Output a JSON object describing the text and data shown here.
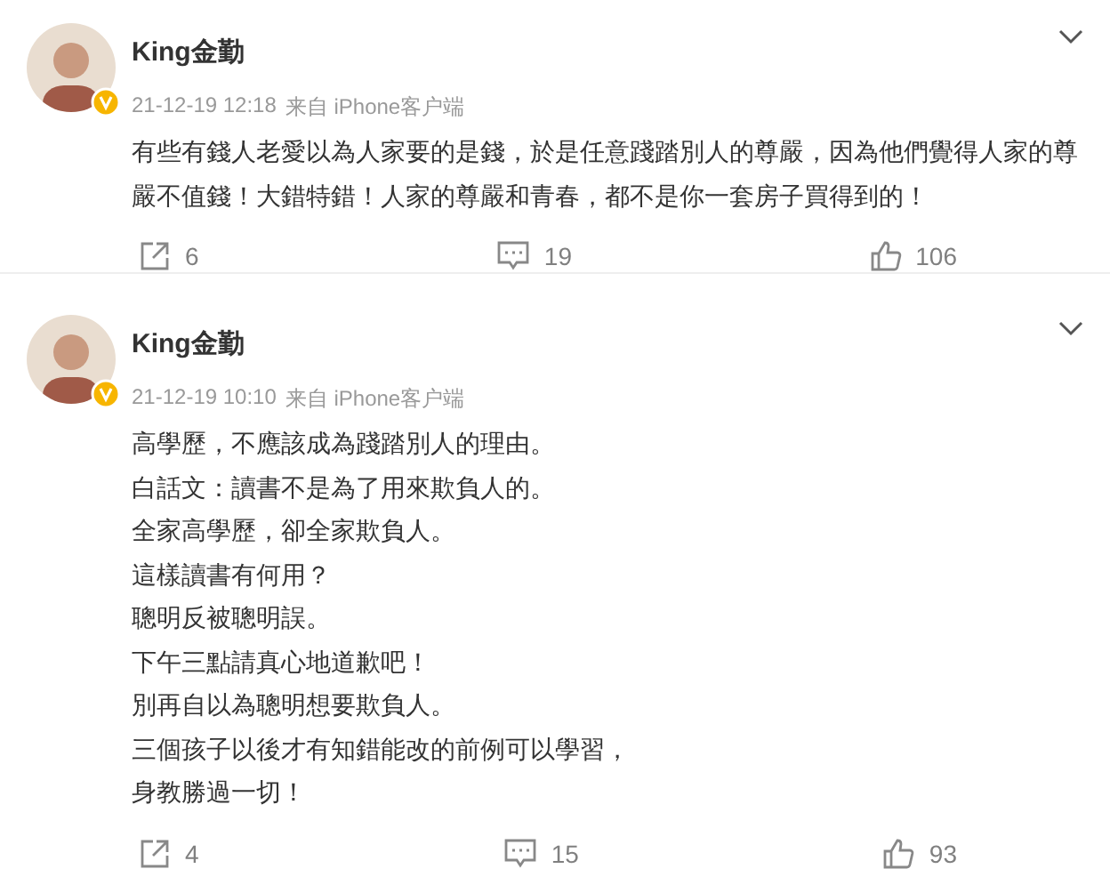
{
  "posts": [
    {
      "author": "King金勤",
      "time": "21-12-19 12:18",
      "source": "来自 iPhone客户端",
      "verified": true,
      "paragraphs": [
        "有些有錢人老愛以為人家要的是錢，於是任意踐踏別人的尊嚴，因為他們覺得人家的尊嚴不值錢！大錯特錯！人家的尊嚴和青春，都不是你一套房子買得到的！"
      ],
      "reposts": "6",
      "comments": "19",
      "likes": "106"
    },
    {
      "author": "King金勤",
      "time": "21-12-19 10:10",
      "source": "来自 iPhone客户端",
      "verified": true,
      "paragraphs": [
        "高學歷，不應該成為踐踏別人的理由。",
        "白話文：讀書不是為了用來欺負人的。",
        "全家高學歷，卻全家欺負人。",
        "這樣讀書有何用？",
        "聰明反被聰明誤。",
        "下午三點請真心地道歉吧！",
        "別再自以為聰明想要欺負人。",
        "三個孩子以後才有知錯能改的前例可以學習，",
        "身教勝過一切！"
      ],
      "reposts": "4",
      "comments": "15",
      "likes": "93"
    }
  ]
}
